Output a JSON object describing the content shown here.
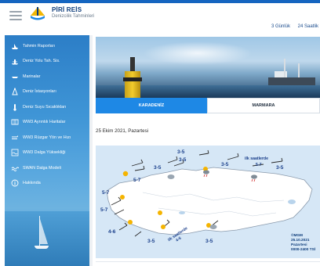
{
  "header": {
    "brand_title": "PİRİ REİS",
    "brand_subtitle": "Denizcilik Tahminleri",
    "range_links": [
      "3 Günlük",
      "24 Saatlik"
    ]
  },
  "sidebar": {
    "items": [
      {
        "label": "Tahmin Raporları",
        "icon": "ship-icon"
      },
      {
        "label": "Deniz Yolu Tah. Sis.",
        "icon": "ship-route-icon"
      },
      {
        "label": "Marinalar",
        "icon": "boat-icon"
      },
      {
        "label": "Deniz İstasyonları",
        "icon": "station-icon"
      },
      {
        "label": "Deniz Suyu Sıcaklıkları",
        "icon": "thermometer-icon"
      },
      {
        "label": "WW3 Ayrıntılı Haritalar",
        "icon": "map-icon"
      },
      {
        "label": "WW3 Rüzgar Yön ve Hızı",
        "icon": "wind-icon"
      },
      {
        "label": "WW3 Dalga Yüksekliği",
        "icon": "wave-chart-icon"
      },
      {
        "label": "SWAN Dalga Modeli",
        "icon": "wave-icon"
      },
      {
        "label": "Hakkında",
        "icon": "info-icon"
      }
    ]
  },
  "tabs": [
    {
      "label": "KARADENİZ",
      "active": true
    },
    {
      "label": "MARMARA",
      "active": false
    }
  ],
  "date_text": "25 Ekim 2021, Pazartesi",
  "map": {
    "labels": [
      "3-5",
      "3-5",
      "3-5",
      "3-5",
      "5-7",
      "5-7",
      "5-7",
      "4-6",
      "3-5",
      "3-5",
      "3-5",
      "4-6"
    ],
    "annotation_lines": [
      "ilk saatlerde",
      "5-7"
    ],
    "bottom_annotation_lines": [
      "ilk saatlerde",
      "4-6"
    ],
    "stamp_lines": [
      "©MGM",
      "25.10.2021",
      "Pazartesi",
      "0000-2400 TSİ"
    ]
  },
  "colors": {
    "accent": "#1e88e5",
    "topbar": "#1565c0",
    "label_blue": "#1a3f8b"
  }
}
